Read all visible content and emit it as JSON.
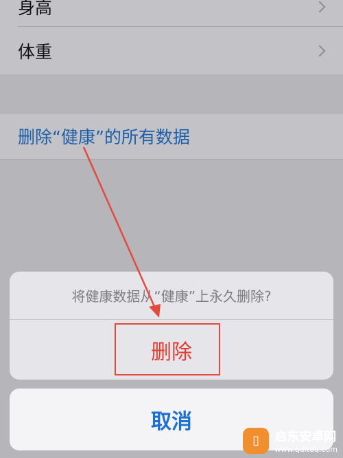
{
  "list": {
    "items": [
      {
        "label": "身高"
      },
      {
        "label": "体重"
      }
    ],
    "delete_all_label": "删除“健康”的所有数据"
  },
  "action_sheet": {
    "message": "将健康数据从“健康”上永久删除?",
    "delete_label": "删除",
    "cancel_label": "取消"
  },
  "watermark": {
    "title": "启东安卓网",
    "url": "www.qdltdq.com",
    "logo_icon": "phone-icon"
  },
  "colors": {
    "destructive": "#e23b30",
    "link_blue": "#1c5fa8",
    "annotation_red": "#e24a40"
  }
}
